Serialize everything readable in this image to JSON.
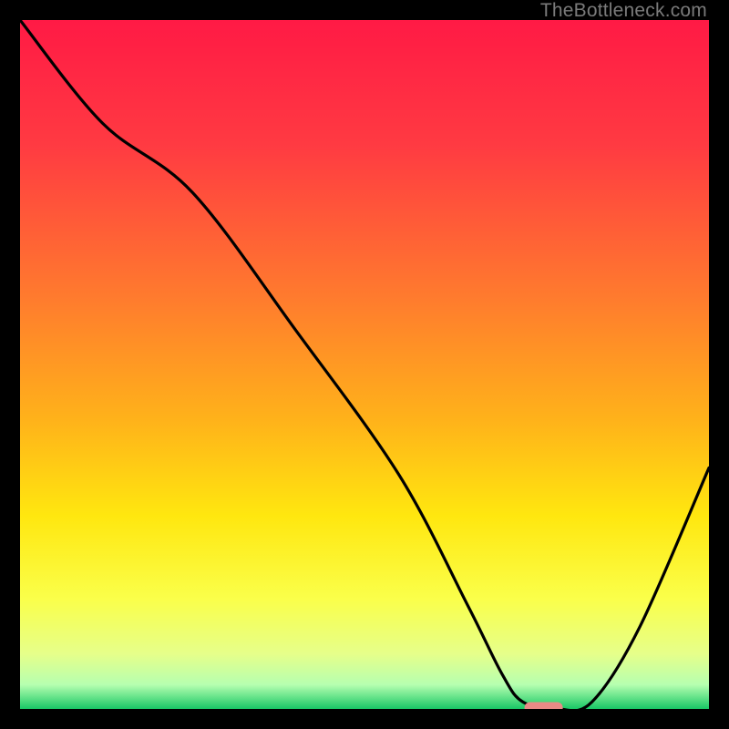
{
  "watermark": "TheBottleneck.com",
  "chart_data": {
    "type": "line",
    "title": "",
    "xlabel": "",
    "ylabel": "",
    "xlim": [
      0,
      100
    ],
    "ylim": [
      0,
      100
    ],
    "x": [
      0,
      12,
      25,
      40,
      55,
      65,
      70,
      73,
      78,
      83,
      90,
      100
    ],
    "values": [
      100,
      85,
      75,
      55,
      34,
      15,
      5,
      1,
      0,
      1,
      12,
      35
    ],
    "minimum_marker": {
      "x": 76,
      "y": 0
    },
    "gradient_stops": [
      {
        "offset": 0.0,
        "color": "#ff1a45"
      },
      {
        "offset": 0.18,
        "color": "#ff3a42"
      },
      {
        "offset": 0.4,
        "color": "#ff7a2e"
      },
      {
        "offset": 0.58,
        "color": "#ffb21a"
      },
      {
        "offset": 0.72,
        "color": "#ffe70f"
      },
      {
        "offset": 0.84,
        "color": "#faff4a"
      },
      {
        "offset": 0.92,
        "color": "#e6ff8a"
      },
      {
        "offset": 0.965,
        "color": "#b6ffb0"
      },
      {
        "offset": 1.0,
        "color": "#18c765"
      }
    ]
  }
}
